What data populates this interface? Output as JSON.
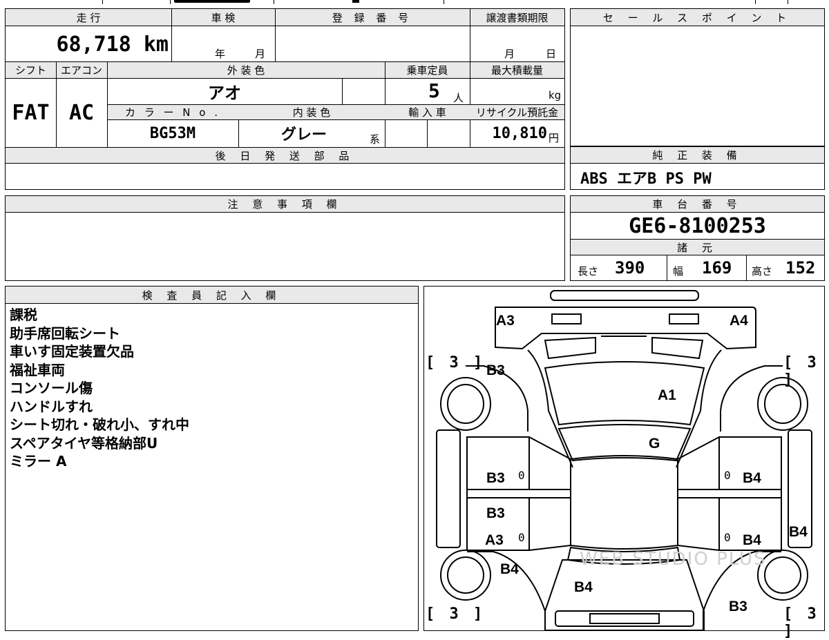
{
  "top_left": {
    "headers": {
      "mileage": "走 行",
      "inspection": "車 検",
      "registration": "登 録 番 号",
      "transfer_deadline": "譲渡書類期限"
    },
    "mileage_value": "68,718 km",
    "inspection_year": "年",
    "inspection_month": "月",
    "transfer_month": "月",
    "transfer_day": "日",
    "row2_headers": {
      "shift": "シフト",
      "aircon": "エアコン",
      "exterior_color": "外 装 色",
      "capacity": "乗車定員",
      "max_load": "最大積載量"
    },
    "shift_value": "FAT",
    "aircon_value": "AC",
    "exterior_color_value": "アオ",
    "capacity_value": "5",
    "capacity_unit": "人",
    "max_load_unit": "kg",
    "row3_headers": {
      "color_no": "カ ラ ー N o .",
      "interior_color": "内 装 色",
      "import": "輸 入 車",
      "recycle_fee": "リサイクル預託金"
    },
    "color_no_value": "BG53M",
    "interior_color_value": "グレー",
    "interior_color_suffix": "系",
    "recycle_fee_value": "10,810",
    "recycle_fee_unit": "円",
    "later_parts_header": "後 日 発 送 部 品"
  },
  "sales_point": {
    "header": "セ ー ル ス ポ イ ン ト"
  },
  "genuine_equipment": {
    "header": "純 正 装 備",
    "value": "ABS エアB PS PW"
  },
  "caution": {
    "header": "注 意 事 項 欄"
  },
  "chassis": {
    "header": "車 台 番 号",
    "value": "GE6-8100253"
  },
  "specs": {
    "header": "諸 元",
    "length_label": "長さ",
    "length_value": "390",
    "width_label": "幅",
    "width_value": "169",
    "height_label": "高さ",
    "height_value": "152"
  },
  "inspector": {
    "header": "検 査 員 記 入 欄",
    "notes": [
      "課税",
      "助手席回転シート",
      "車いす固定装置欠品",
      "福祉車両",
      "コンソール傷",
      "ハンドルすれ",
      "シート切れ・破れ小、すれ中",
      "スペアタイヤ等格納部U",
      "ミラー A"
    ]
  },
  "diagram": {
    "labels": {
      "a3_top": "A3",
      "a4_top": "A4",
      "b3_upper_left": "B3",
      "a1": "A1",
      "g": "G",
      "b3_mid_left": "B3",
      "b4_mid_right": "B4",
      "b3_low_left": "B3",
      "a3_low_left": "A3",
      "b4_low_right": "B4",
      "b4_far_right": "B4",
      "b4_bottom_left": "B4",
      "b4_bottom_center": "B4",
      "b3_bottom_right": "B3"
    },
    "zeros": [
      "0",
      "0",
      "0",
      "0"
    ],
    "brackets": {
      "tl": "[ 3 ]",
      "tr": "[ 3 ]",
      "bl": "[ 3 ]",
      "br": "[ 3 ]"
    },
    "watermark": "WEB STUDIO PLUS"
  },
  "colors": {
    "header_bg": "#e9e9e9",
    "line": "#000000"
  }
}
